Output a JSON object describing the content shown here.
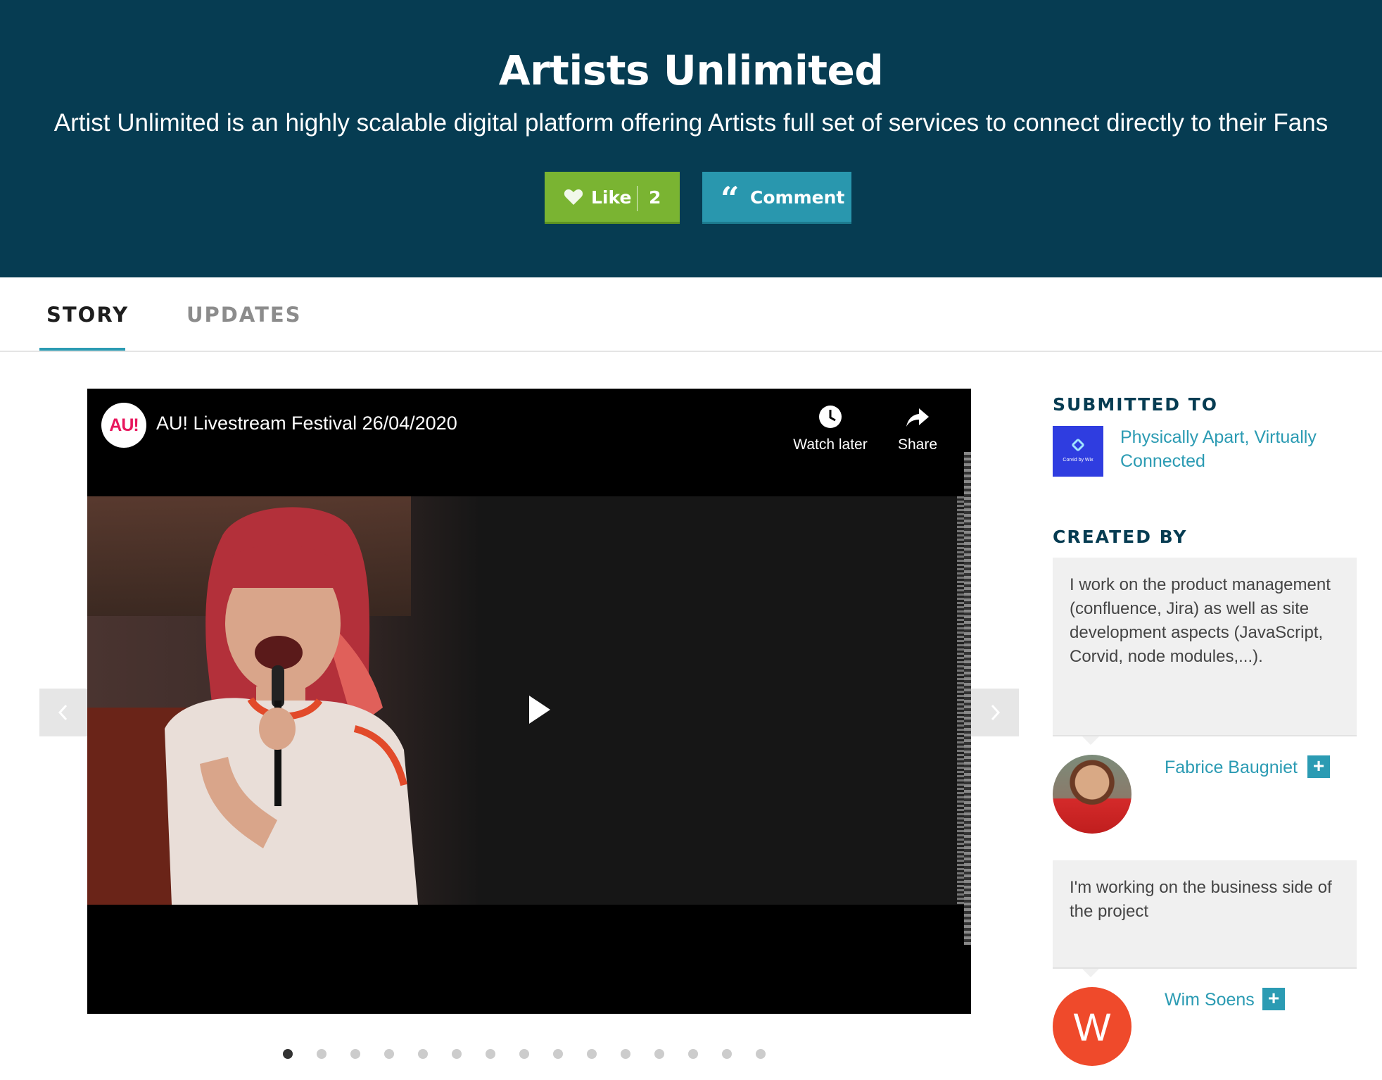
{
  "hero": {
    "title": "Artists Unlimited",
    "subtitle": "Artist Unlimited is an highly scalable digital platform offering Artists full set of services to connect directly to their Fans",
    "like_label": "Like",
    "like_count": "2",
    "comment_label": "Comment",
    "bg_color": "#063c52",
    "like_color": "#7ab432",
    "comment_color": "#2997ae"
  },
  "tabs": [
    {
      "label": "STORY",
      "active": true
    },
    {
      "label": "UPDATES",
      "active": false
    }
  ],
  "video": {
    "channel_logo_text": "AU!",
    "title": "AU! Livestream Festival 26/04/2020",
    "watch_later_label": "Watch later",
    "share_label": "Share",
    "icons": [
      "clock-icon",
      "share-arrow-icon",
      "play-icon"
    ]
  },
  "carousel": {
    "slide_count": 15,
    "active_index": 0
  },
  "sidebar": {
    "submitted_heading": "SUBMITTED TO",
    "challenge_logo_text": "Corvid by Wix",
    "challenge_name": "Physically Apart, Virtually Connected",
    "created_heading": "CREATED BY",
    "creators": [
      {
        "bio": "I work on the product management (confluence, Jira) as well as site development aspects (JavaScript, Corvid, node modules,...).",
        "name": "Fabrice Baugniet",
        "follow": "+"
      },
      {
        "bio": "I'm working on the business side of the project",
        "name": "Wim Soens",
        "initial": "W",
        "follow": "+"
      }
    ]
  }
}
